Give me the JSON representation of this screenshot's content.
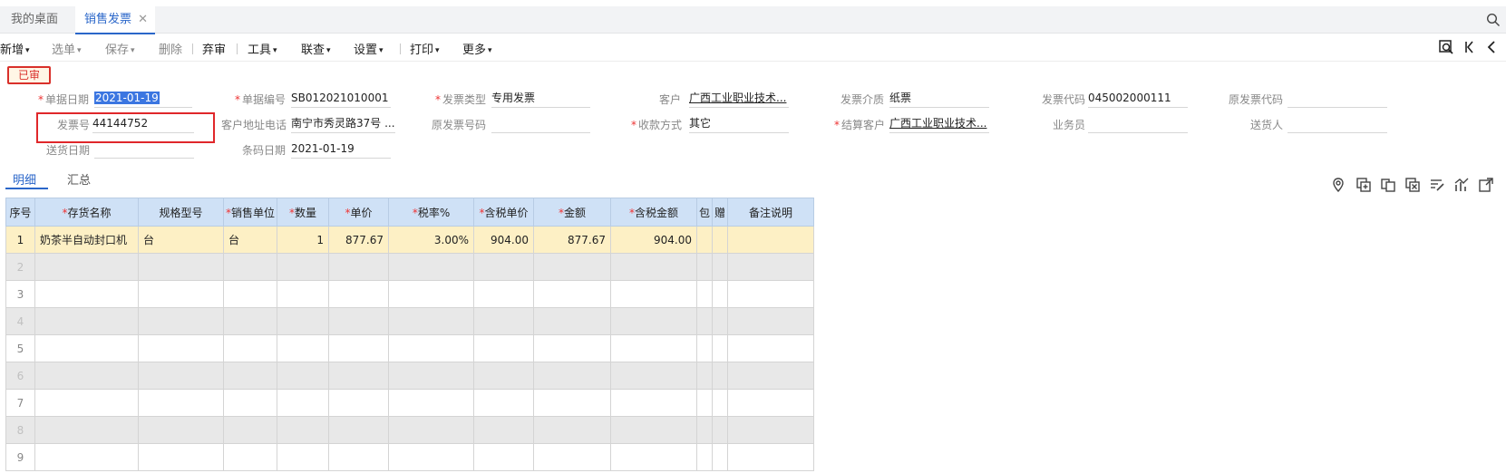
{
  "tabs": [
    {
      "label": "我的桌面"
    },
    {
      "label": "销售发票",
      "close": "✕"
    }
  ],
  "toolbar": {
    "new": "新增",
    "select": "选单",
    "save": "保存",
    "delete": "删除",
    "abandon": "弃审",
    "tools": "工具",
    "query": "联查",
    "settings": "设置",
    "print": "打印",
    "more": "更多"
  },
  "status_badge": "已审",
  "form": {
    "doc_date": {
      "label": "单据日期",
      "value": "2021-01-19"
    },
    "doc_no": {
      "label": "单据编号",
      "value": "SB012021010001"
    },
    "invoice_type": {
      "label": "发票类型",
      "value": "专用发票"
    },
    "customer": {
      "label": "客户",
      "value": "广西工业职业技术..."
    },
    "invoice_medium": {
      "label": "发票介质",
      "value": "纸票"
    },
    "invoice_code": {
      "label": "发票代码",
      "value": "045002000111"
    },
    "orig_invoice_code": {
      "label": "原发票代码",
      "value": ""
    },
    "invoice_no": {
      "label": "发票号",
      "value": "44144752"
    },
    "cust_addr_phone": {
      "label": "客户地址电话",
      "value": "南宁市秀灵路37号 ..."
    },
    "orig_invoice_no": {
      "label": "原发票号码",
      "value": ""
    },
    "payment_method": {
      "label": "收款方式",
      "value": "其它"
    },
    "settle_customer": {
      "label": "结算客户",
      "value": "广西工业职业技术..."
    },
    "salesperson": {
      "label": "业务员",
      "value": ""
    },
    "deliverer": {
      "label": "送货人",
      "value": ""
    },
    "delivery_date": {
      "label": "送货日期",
      "value": ""
    },
    "barcode_date": {
      "label": "条码日期",
      "value": "2021-01-19"
    }
  },
  "detail_tabs": [
    "明细",
    "汇总"
  ],
  "grid": {
    "columns": [
      "序号",
      "存货名称",
      "规格型号",
      "销售单位",
      "数量",
      "单价",
      "税率%",
      "含税单价",
      "金额",
      "含税金额",
      "包",
      "赠",
      "备注说明"
    ],
    "rows": [
      {
        "idx": "1",
        "name": "奶茶半自动封口机",
        "spec": "台",
        "unit": "台",
        "qty": "1",
        "price": "877.67",
        "tax_rate": "3.00%",
        "tax_price": "904.00",
        "amount": "877.67",
        "tax_amount": "904.00"
      },
      {
        "idx": "2"
      },
      {
        "idx": "3"
      },
      {
        "idx": "4"
      },
      {
        "idx": "5"
      },
      {
        "idx": "6"
      },
      {
        "idx": "7"
      },
      {
        "idx": "8"
      },
      {
        "idx": "9"
      }
    ]
  },
  "colors": {
    "accent": "#2a66c9",
    "required": "#ee3333",
    "badge": "#d9302a",
    "selected_row": "#fdf0c5",
    "header": "#cfe1f6"
  }
}
